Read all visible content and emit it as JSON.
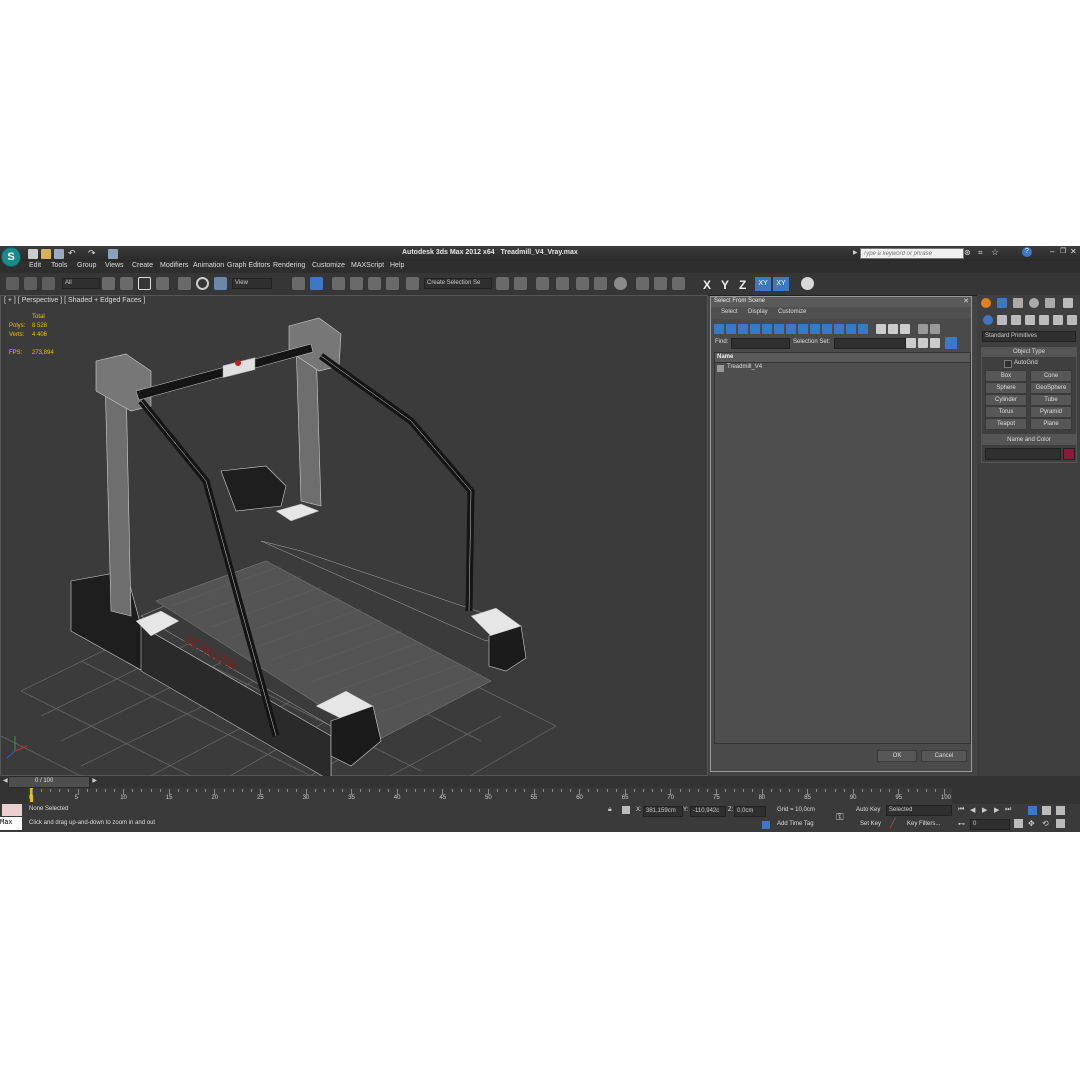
{
  "app": {
    "title": "Autodesk 3ds Max  2012 x64",
    "file": "Treadmill_V4_Vray.max",
    "search_placeholder": "Type a keyword or phrase",
    "logo_text": "S"
  },
  "menu": [
    "Edit",
    "Tools",
    "Group",
    "Views",
    "Create",
    "Modifiers",
    "Animation",
    "Graph Editors",
    "Rendering",
    "Customize",
    "MAXScript",
    "Help"
  ],
  "toolbar": {
    "filter_value": "All",
    "view_value": "View",
    "selection_set_value": "Create Selection Se",
    "axes": [
      "X",
      "Y",
      "Z",
      "XY",
      "XY"
    ]
  },
  "viewport": {
    "label": "[ + ] [ Perspective ] [ Shaded + Edged Faces ]",
    "stats_header": "Total",
    "stats": [
      {
        "label": "Polys:",
        "value": "8 528"
      },
      {
        "label": "Verts:",
        "value": "4 406"
      }
    ],
    "fps_label": "FPS:",
    "fps_value": "273,894",
    "brand_text": "SCHILLER"
  },
  "dialog": {
    "title": "Select From Scene",
    "menus": [
      "Select",
      "Display",
      "Customize"
    ],
    "find_label": "Find:",
    "selection_set_label": "Selection Set:",
    "column_name": "Name",
    "items": [
      "Treadmill_V4"
    ],
    "ok": "OK",
    "cancel": "Cancel"
  },
  "command_panel": {
    "dropdown": "Standard Primitives",
    "object_type_header": "Object Type",
    "autogrid": "AutoGrid",
    "buttons": [
      "Box",
      "Cone",
      "Sphere",
      "GeoSphere",
      "Cylinder",
      "Tube",
      "Torus",
      "Pyramid",
      "Teapot",
      "Plane"
    ],
    "name_color_header": "Name and Color",
    "object_color": "#8b1a3a"
  },
  "timeline": {
    "frame_counter": "0 / 100",
    "ticks": [
      "0",
      "5",
      "10",
      "15",
      "20",
      "25",
      "30",
      "35",
      "40",
      "45",
      "50",
      "55",
      "60",
      "65",
      "70",
      "75",
      "80",
      "85",
      "90",
      "95",
      "100"
    ]
  },
  "status": {
    "selection": "None Selected",
    "prompt": "Click and drag up-and-down to zoom in and out",
    "x_label": "X:",
    "x_value": "381,159cm",
    "y_label": "Y:",
    "y_value": "-110,942c",
    "z_label": "Z:",
    "z_value": "0,0cm",
    "grid": "Grid = 10,0cm",
    "add_time_tag": "Add Time Tag",
    "auto_key": "Auto Key",
    "auto_key_value": "Selected",
    "set_key": "Set Key",
    "key_filters": "Key Filters...",
    "frame_field": "0",
    "maxscript_label": "Max"
  }
}
